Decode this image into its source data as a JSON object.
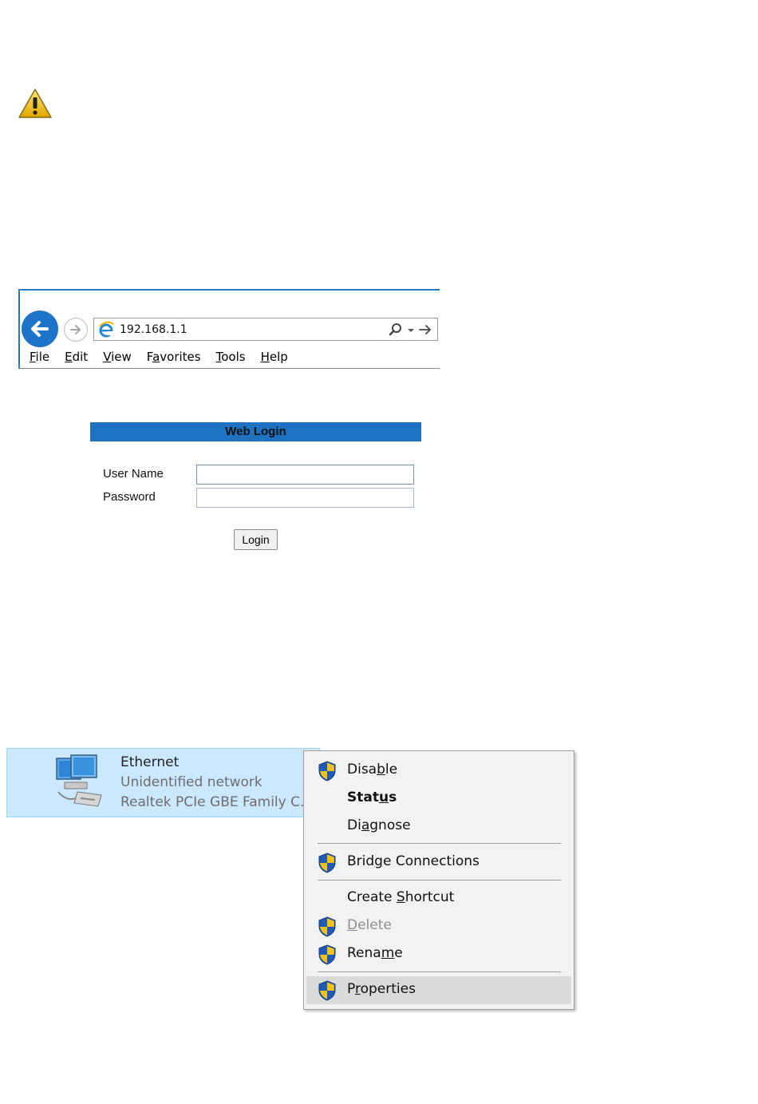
{
  "browser": {
    "address": "192.168.1.1",
    "menu": [
      "File",
      "Edit",
      "View",
      "Favorites",
      "Tools",
      "Help"
    ],
    "menu_accel": [
      "F",
      "E",
      "V",
      "a",
      "T",
      "H"
    ]
  },
  "login": {
    "title": "Web Login",
    "username_label": "User Name",
    "password_label": "Password",
    "username_value": "",
    "password_value": "",
    "button": "Login"
  },
  "adapter": {
    "name": "Ethernet",
    "status": "Unidentified network",
    "device": "Realtek PCIe GBE Family C..."
  },
  "context_menu": {
    "items": [
      {
        "pre": "Disa",
        "acc": "b",
        "post": "le",
        "shield": true,
        "state": "normal"
      },
      {
        "pre": "Stat",
        "acc": "u",
        "post": "s",
        "shield": false,
        "state": "bold"
      },
      {
        "pre": "Di",
        "acc": "a",
        "post": "gnose",
        "shield": false,
        "state": "normal"
      },
      {
        "pre": "Brid",
        "acc": "g",
        "post": "e Connections",
        "shield": true,
        "state": "normal"
      },
      {
        "pre": "Create ",
        "acc": "S",
        "post": "hortcut",
        "shield": false,
        "state": "normal"
      },
      {
        "pre": "",
        "acc": "D",
        "post": "elete",
        "shield": true,
        "state": "disabled"
      },
      {
        "pre": "Rena",
        "acc": "m",
        "post": "e",
        "shield": true,
        "state": "normal"
      },
      {
        "pre": "P",
        "acc": "r",
        "post": "operties",
        "shield": true,
        "state": "highlighted"
      }
    ]
  }
}
